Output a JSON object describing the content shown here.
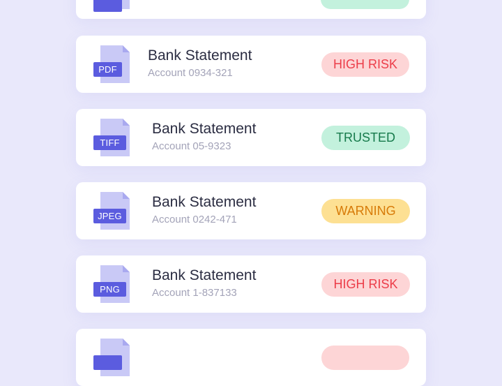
{
  "colors": {
    "background": "#e9e8fb",
    "card": "#ffffff",
    "file_tag": "#5b5cdf",
    "file_page": "#c9c9f6",
    "high_risk_bg": "#fdd5d6",
    "high_risk_text": "#ec3d49",
    "trusted_bg": "#c3f1dd",
    "trusted_text": "#167a4b",
    "warning_bg": "#fde093",
    "warning_text": "#d77a08"
  },
  "documents": [
    {
      "icon": "file-icon",
      "file_type": "",
      "title": "",
      "account": "",
      "status": ""
    },
    {
      "icon": "file-icon",
      "file_type": "PDF",
      "title": "Bank Statement",
      "account": "Account 0934-321",
      "status": "HIGH RISK"
    },
    {
      "icon": "file-icon",
      "file_type": "TIFF",
      "title": "Bank Statement",
      "account": "Account 05-9323",
      "status": "TRUSTED"
    },
    {
      "icon": "file-icon",
      "file_type": "JPEG",
      "title": "Bank Statement",
      "account": "Account 0242-471",
      "status": "WARNING"
    },
    {
      "icon": "file-icon",
      "file_type": "PNG",
      "title": "Bank Statement",
      "account": "Account 1-837133",
      "status": "HIGH RISK"
    },
    {
      "icon": "file-icon",
      "file_type": "",
      "title": "",
      "account": "",
      "status": ""
    }
  ]
}
